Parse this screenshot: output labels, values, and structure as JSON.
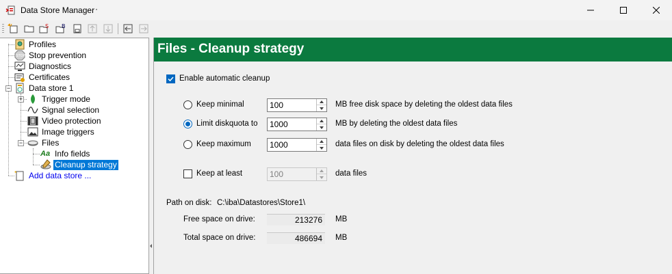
{
  "window": {
    "title": "Data Store Manager",
    "title_suffix": "·"
  },
  "tree": {
    "items": [
      {
        "label": "Profiles",
        "icon": "profiles-icon"
      },
      {
        "label": "Stop prevention",
        "icon": "stop-icon"
      },
      {
        "label": "Diagnostics",
        "icon": "diagnostics-icon"
      },
      {
        "label": "Certificates",
        "icon": "certificates-icon"
      },
      {
        "label": "Data store 1",
        "icon": "datastore-icon"
      },
      {
        "label": "Trigger mode",
        "icon": "trigger-icon"
      },
      {
        "label": "Signal selection",
        "icon": "signal-icon"
      },
      {
        "label": "Video protection",
        "icon": "video-icon"
      },
      {
        "label": "Image triggers",
        "icon": "image-icon"
      },
      {
        "label": "Files",
        "icon": "files-icon"
      },
      {
        "label": "Info fields",
        "icon": "info-fields-icon",
        "glyph": "Aa"
      },
      {
        "label": "Cleanup strategy",
        "icon": "cleanup-icon"
      },
      {
        "label": "Add data store ...",
        "icon": "add-datastore-icon"
      }
    ]
  },
  "panel": {
    "title": "Files - Cleanup strategy",
    "enable_label": "Enable automatic cleanup",
    "enable_checked": true,
    "options": [
      {
        "label": "Keep minimal",
        "value": "100",
        "suffix": "MB free disk space by deleting the oldest data files",
        "selected": false
      },
      {
        "label": "Limit diskquota to",
        "value": "1000",
        "suffix": "MB by deleting the oldest data files",
        "selected": true
      },
      {
        "label": "Keep maximum",
        "value": "1000",
        "suffix": "data files on disk by deleting the oldest data files",
        "selected": false
      }
    ],
    "keep_at_least": {
      "label": "Keep at least",
      "value": "100",
      "suffix": "data files",
      "checked": false
    },
    "path_label": "Path on disk:",
    "path_value": "C:\\iba\\Datastores\\Store1\\",
    "free_space_label": "Free space on drive:",
    "free_space_value": "213276",
    "free_space_unit": "MB",
    "total_space_label": "Total space on drive:",
    "total_space_value": "486694",
    "total_space_unit": "MB"
  },
  "colors": {
    "header_green": "#0b7a3f",
    "accent_blue": "#0067c0",
    "selection_blue": "#0078d7"
  }
}
